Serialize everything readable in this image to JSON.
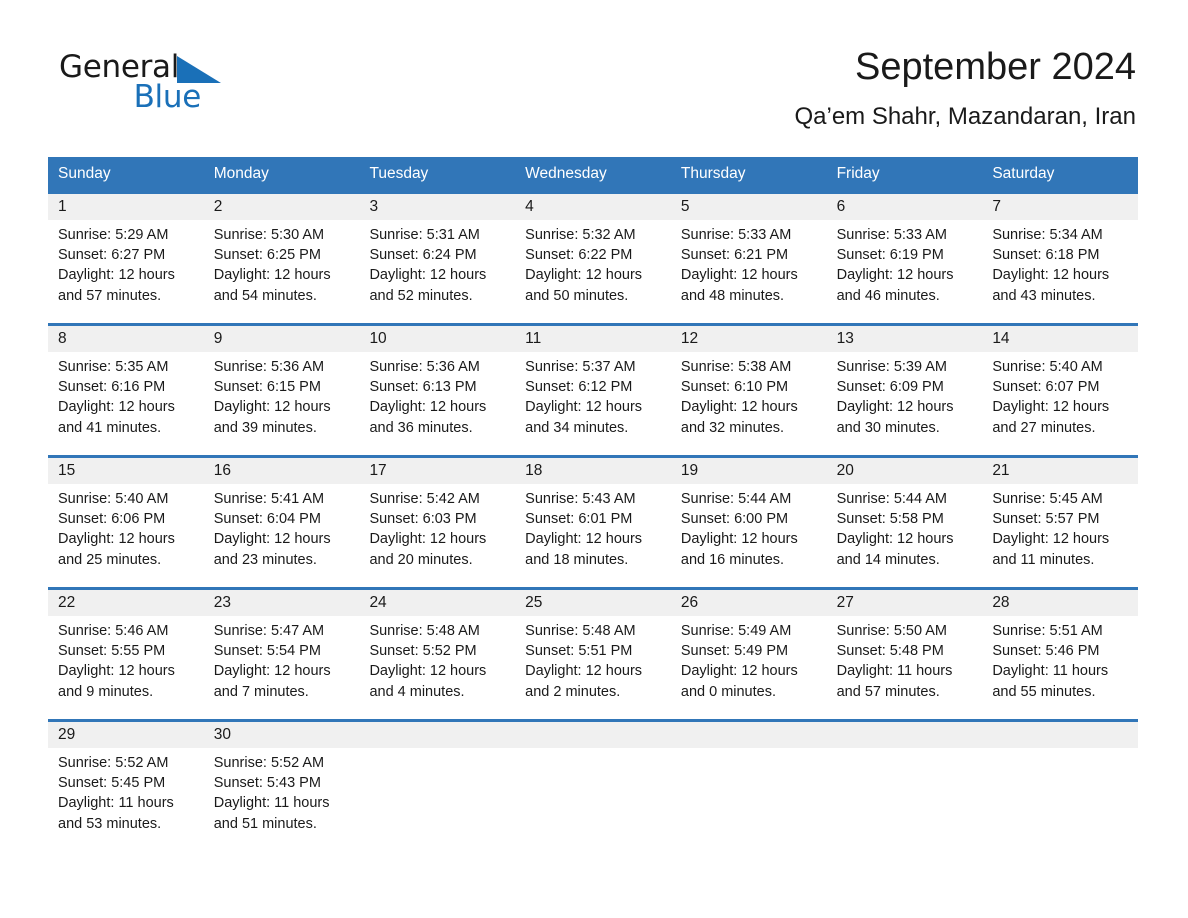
{
  "brand": {
    "name_part1": "General",
    "name_part2": "Blue",
    "triangle_color": "#1a70b8"
  },
  "header": {
    "month_title": "September 2024",
    "location": "Qa’em Shahr, Mazandaran, Iran"
  },
  "theme": {
    "header_blue": "#3176b8",
    "date_band_gray": "#f0f0f0",
    "text": "#1a1a1a"
  },
  "weekdays": [
    "Sunday",
    "Monday",
    "Tuesday",
    "Wednesday",
    "Thursday",
    "Friday",
    "Saturday"
  ],
  "weeks": [
    [
      {
        "day": "1",
        "sunrise": "Sunrise: 5:29 AM",
        "sunset": "Sunset: 6:27 PM",
        "daylight1": "Daylight: 12 hours",
        "daylight2": "and 57 minutes."
      },
      {
        "day": "2",
        "sunrise": "Sunrise: 5:30 AM",
        "sunset": "Sunset: 6:25 PM",
        "daylight1": "Daylight: 12 hours",
        "daylight2": "and 54 minutes."
      },
      {
        "day": "3",
        "sunrise": "Sunrise: 5:31 AM",
        "sunset": "Sunset: 6:24 PM",
        "daylight1": "Daylight: 12 hours",
        "daylight2": "and 52 minutes."
      },
      {
        "day": "4",
        "sunrise": "Sunrise: 5:32 AM",
        "sunset": "Sunset: 6:22 PM",
        "daylight1": "Daylight: 12 hours",
        "daylight2": "and 50 minutes."
      },
      {
        "day": "5",
        "sunrise": "Sunrise: 5:33 AM",
        "sunset": "Sunset: 6:21 PM",
        "daylight1": "Daylight: 12 hours",
        "daylight2": "and 48 minutes."
      },
      {
        "day": "6",
        "sunrise": "Sunrise: 5:33 AM",
        "sunset": "Sunset: 6:19 PM",
        "daylight1": "Daylight: 12 hours",
        "daylight2": "and 46 minutes."
      },
      {
        "day": "7",
        "sunrise": "Sunrise: 5:34 AM",
        "sunset": "Sunset: 6:18 PM",
        "daylight1": "Daylight: 12 hours",
        "daylight2": "and 43 minutes."
      }
    ],
    [
      {
        "day": "8",
        "sunrise": "Sunrise: 5:35 AM",
        "sunset": "Sunset: 6:16 PM",
        "daylight1": "Daylight: 12 hours",
        "daylight2": "and 41 minutes."
      },
      {
        "day": "9",
        "sunrise": "Sunrise: 5:36 AM",
        "sunset": "Sunset: 6:15 PM",
        "daylight1": "Daylight: 12 hours",
        "daylight2": "and 39 minutes."
      },
      {
        "day": "10",
        "sunrise": "Sunrise: 5:36 AM",
        "sunset": "Sunset: 6:13 PM",
        "daylight1": "Daylight: 12 hours",
        "daylight2": "and 36 minutes."
      },
      {
        "day": "11",
        "sunrise": "Sunrise: 5:37 AM",
        "sunset": "Sunset: 6:12 PM",
        "daylight1": "Daylight: 12 hours",
        "daylight2": "and 34 minutes."
      },
      {
        "day": "12",
        "sunrise": "Sunrise: 5:38 AM",
        "sunset": "Sunset: 6:10 PM",
        "daylight1": "Daylight: 12 hours",
        "daylight2": "and 32 minutes."
      },
      {
        "day": "13",
        "sunrise": "Sunrise: 5:39 AM",
        "sunset": "Sunset: 6:09 PM",
        "daylight1": "Daylight: 12 hours",
        "daylight2": "and 30 minutes."
      },
      {
        "day": "14",
        "sunrise": "Sunrise: 5:40 AM",
        "sunset": "Sunset: 6:07 PM",
        "daylight1": "Daylight: 12 hours",
        "daylight2": "and 27 minutes."
      }
    ],
    [
      {
        "day": "15",
        "sunrise": "Sunrise: 5:40 AM",
        "sunset": "Sunset: 6:06 PM",
        "daylight1": "Daylight: 12 hours",
        "daylight2": "and 25 minutes."
      },
      {
        "day": "16",
        "sunrise": "Sunrise: 5:41 AM",
        "sunset": "Sunset: 6:04 PM",
        "daylight1": "Daylight: 12 hours",
        "daylight2": "and 23 minutes."
      },
      {
        "day": "17",
        "sunrise": "Sunrise: 5:42 AM",
        "sunset": "Sunset: 6:03 PM",
        "daylight1": "Daylight: 12 hours",
        "daylight2": "and 20 minutes."
      },
      {
        "day": "18",
        "sunrise": "Sunrise: 5:43 AM",
        "sunset": "Sunset: 6:01 PM",
        "daylight1": "Daylight: 12 hours",
        "daylight2": "and 18 minutes."
      },
      {
        "day": "19",
        "sunrise": "Sunrise: 5:44 AM",
        "sunset": "Sunset: 6:00 PM",
        "daylight1": "Daylight: 12 hours",
        "daylight2": "and 16 minutes."
      },
      {
        "day": "20",
        "sunrise": "Sunrise: 5:44 AM",
        "sunset": "Sunset: 5:58 PM",
        "daylight1": "Daylight: 12 hours",
        "daylight2": "and 14 minutes."
      },
      {
        "day": "21",
        "sunrise": "Sunrise: 5:45 AM",
        "sunset": "Sunset: 5:57 PM",
        "daylight1": "Daylight: 12 hours",
        "daylight2": "and 11 minutes."
      }
    ],
    [
      {
        "day": "22",
        "sunrise": "Sunrise: 5:46 AM",
        "sunset": "Sunset: 5:55 PM",
        "daylight1": "Daylight: 12 hours",
        "daylight2": "and 9 minutes."
      },
      {
        "day": "23",
        "sunrise": "Sunrise: 5:47 AM",
        "sunset": "Sunset: 5:54 PM",
        "daylight1": "Daylight: 12 hours",
        "daylight2": "and 7 minutes."
      },
      {
        "day": "24",
        "sunrise": "Sunrise: 5:48 AM",
        "sunset": "Sunset: 5:52 PM",
        "daylight1": "Daylight: 12 hours",
        "daylight2": "and 4 minutes."
      },
      {
        "day": "25",
        "sunrise": "Sunrise: 5:48 AM",
        "sunset": "Sunset: 5:51 PM",
        "daylight1": "Daylight: 12 hours",
        "daylight2": "and 2 minutes."
      },
      {
        "day": "26",
        "sunrise": "Sunrise: 5:49 AM",
        "sunset": "Sunset: 5:49 PM",
        "daylight1": "Daylight: 12 hours",
        "daylight2": "and 0 minutes."
      },
      {
        "day": "27",
        "sunrise": "Sunrise: 5:50 AM",
        "sunset": "Sunset: 5:48 PM",
        "daylight1": "Daylight: 11 hours",
        "daylight2": "and 57 minutes."
      },
      {
        "day": "28",
        "sunrise": "Sunrise: 5:51 AM",
        "sunset": "Sunset: 5:46 PM",
        "daylight1": "Daylight: 11 hours",
        "daylight2": "and 55 minutes."
      }
    ],
    [
      {
        "day": "29",
        "sunrise": "Sunrise: 5:52 AM",
        "sunset": "Sunset: 5:45 PM",
        "daylight1": "Daylight: 11 hours",
        "daylight2": "and 53 minutes."
      },
      {
        "day": "30",
        "sunrise": "Sunrise: 5:52 AM",
        "sunset": "Sunset: 5:43 PM",
        "daylight1": "Daylight: 11 hours",
        "daylight2": "and 51 minutes."
      },
      {
        "day": "",
        "sunrise": "",
        "sunset": "",
        "daylight1": "",
        "daylight2": ""
      },
      {
        "day": "",
        "sunrise": "",
        "sunset": "",
        "daylight1": "",
        "daylight2": ""
      },
      {
        "day": "",
        "sunrise": "",
        "sunset": "",
        "daylight1": "",
        "daylight2": ""
      },
      {
        "day": "",
        "sunrise": "",
        "sunset": "",
        "daylight1": "",
        "daylight2": ""
      },
      {
        "day": "",
        "sunrise": "",
        "sunset": "",
        "daylight1": "",
        "daylight2": ""
      }
    ]
  ]
}
